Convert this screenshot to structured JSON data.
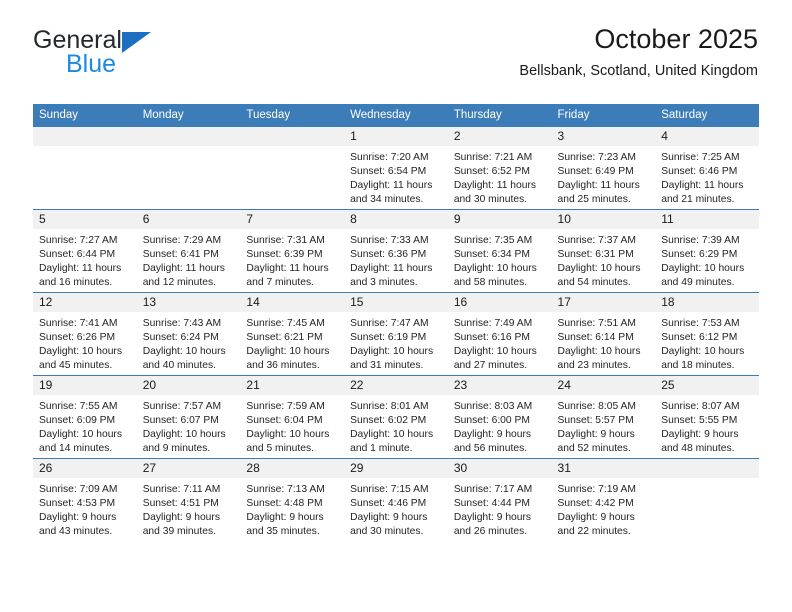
{
  "brand": {
    "name_top": "General",
    "name_bottom": "Blue",
    "triangle_color": "#1c6fc0",
    "bottom_color": "#1c8ae0"
  },
  "header": {
    "title": "October 2025",
    "subtitle": "Bellsbank, Scotland, United Kingdom"
  },
  "theme": {
    "header_blue": "#3c7cb8",
    "daynum_gray": "#f1f1f1",
    "text": "#1a1a1a"
  },
  "weekdays": [
    "Sunday",
    "Monday",
    "Tuesday",
    "Wednesday",
    "Thursday",
    "Friday",
    "Saturday"
  ],
  "labels": {
    "sunrise_prefix": "Sunrise:",
    "sunset_prefix": "Sunset:",
    "daylight_prefix": "Daylight:"
  },
  "weeks": [
    [
      {
        "day": "",
        "sunrise": "",
        "sunset": "",
        "daylight": ""
      },
      {
        "day": "",
        "sunrise": "",
        "sunset": "",
        "daylight": ""
      },
      {
        "day": "",
        "sunrise": "",
        "sunset": "",
        "daylight": ""
      },
      {
        "day": "1",
        "sunrise": "Sunrise: 7:20 AM",
        "sunset": "Sunset: 6:54 PM",
        "daylight": "Daylight: 11 hours and 34 minutes."
      },
      {
        "day": "2",
        "sunrise": "Sunrise: 7:21 AM",
        "sunset": "Sunset: 6:52 PM",
        "daylight": "Daylight: 11 hours and 30 minutes."
      },
      {
        "day": "3",
        "sunrise": "Sunrise: 7:23 AM",
        "sunset": "Sunset: 6:49 PM",
        "daylight": "Daylight: 11 hours and 25 minutes."
      },
      {
        "day": "4",
        "sunrise": "Sunrise: 7:25 AM",
        "sunset": "Sunset: 6:46 PM",
        "daylight": "Daylight: 11 hours and 21 minutes."
      }
    ],
    [
      {
        "day": "5",
        "sunrise": "Sunrise: 7:27 AM",
        "sunset": "Sunset: 6:44 PM",
        "daylight": "Daylight: 11 hours and 16 minutes."
      },
      {
        "day": "6",
        "sunrise": "Sunrise: 7:29 AM",
        "sunset": "Sunset: 6:41 PM",
        "daylight": "Daylight: 11 hours and 12 minutes."
      },
      {
        "day": "7",
        "sunrise": "Sunrise: 7:31 AM",
        "sunset": "Sunset: 6:39 PM",
        "daylight": "Daylight: 11 hours and 7 minutes."
      },
      {
        "day": "8",
        "sunrise": "Sunrise: 7:33 AM",
        "sunset": "Sunset: 6:36 PM",
        "daylight": "Daylight: 11 hours and 3 minutes."
      },
      {
        "day": "9",
        "sunrise": "Sunrise: 7:35 AM",
        "sunset": "Sunset: 6:34 PM",
        "daylight": "Daylight: 10 hours and 58 minutes."
      },
      {
        "day": "10",
        "sunrise": "Sunrise: 7:37 AM",
        "sunset": "Sunset: 6:31 PM",
        "daylight": "Daylight: 10 hours and 54 minutes."
      },
      {
        "day": "11",
        "sunrise": "Sunrise: 7:39 AM",
        "sunset": "Sunset: 6:29 PM",
        "daylight": "Daylight: 10 hours and 49 minutes."
      }
    ],
    [
      {
        "day": "12",
        "sunrise": "Sunrise: 7:41 AM",
        "sunset": "Sunset: 6:26 PM",
        "daylight": "Daylight: 10 hours and 45 minutes."
      },
      {
        "day": "13",
        "sunrise": "Sunrise: 7:43 AM",
        "sunset": "Sunset: 6:24 PM",
        "daylight": "Daylight: 10 hours and 40 minutes."
      },
      {
        "day": "14",
        "sunrise": "Sunrise: 7:45 AM",
        "sunset": "Sunset: 6:21 PM",
        "daylight": "Daylight: 10 hours and 36 minutes."
      },
      {
        "day": "15",
        "sunrise": "Sunrise: 7:47 AM",
        "sunset": "Sunset: 6:19 PM",
        "daylight": "Daylight: 10 hours and 31 minutes."
      },
      {
        "day": "16",
        "sunrise": "Sunrise: 7:49 AM",
        "sunset": "Sunset: 6:16 PM",
        "daylight": "Daylight: 10 hours and 27 minutes."
      },
      {
        "day": "17",
        "sunrise": "Sunrise: 7:51 AM",
        "sunset": "Sunset: 6:14 PM",
        "daylight": "Daylight: 10 hours and 23 minutes."
      },
      {
        "day": "18",
        "sunrise": "Sunrise: 7:53 AM",
        "sunset": "Sunset: 6:12 PM",
        "daylight": "Daylight: 10 hours and 18 minutes."
      }
    ],
    [
      {
        "day": "19",
        "sunrise": "Sunrise: 7:55 AM",
        "sunset": "Sunset: 6:09 PM",
        "daylight": "Daylight: 10 hours and 14 minutes."
      },
      {
        "day": "20",
        "sunrise": "Sunrise: 7:57 AM",
        "sunset": "Sunset: 6:07 PM",
        "daylight": "Daylight: 10 hours and 9 minutes."
      },
      {
        "day": "21",
        "sunrise": "Sunrise: 7:59 AM",
        "sunset": "Sunset: 6:04 PM",
        "daylight": "Daylight: 10 hours and 5 minutes."
      },
      {
        "day": "22",
        "sunrise": "Sunrise: 8:01 AM",
        "sunset": "Sunset: 6:02 PM",
        "daylight": "Daylight: 10 hours and 1 minute."
      },
      {
        "day": "23",
        "sunrise": "Sunrise: 8:03 AM",
        "sunset": "Sunset: 6:00 PM",
        "daylight": "Daylight: 9 hours and 56 minutes."
      },
      {
        "day": "24",
        "sunrise": "Sunrise: 8:05 AM",
        "sunset": "Sunset: 5:57 PM",
        "daylight": "Daylight: 9 hours and 52 minutes."
      },
      {
        "day": "25",
        "sunrise": "Sunrise: 8:07 AM",
        "sunset": "Sunset: 5:55 PM",
        "daylight": "Daylight: 9 hours and 48 minutes."
      }
    ],
    [
      {
        "day": "26",
        "sunrise": "Sunrise: 7:09 AM",
        "sunset": "Sunset: 4:53 PM",
        "daylight": "Daylight: 9 hours and 43 minutes."
      },
      {
        "day": "27",
        "sunrise": "Sunrise: 7:11 AM",
        "sunset": "Sunset: 4:51 PM",
        "daylight": "Daylight: 9 hours and 39 minutes."
      },
      {
        "day": "28",
        "sunrise": "Sunrise: 7:13 AM",
        "sunset": "Sunset: 4:48 PM",
        "daylight": "Daylight: 9 hours and 35 minutes."
      },
      {
        "day": "29",
        "sunrise": "Sunrise: 7:15 AM",
        "sunset": "Sunset: 4:46 PM",
        "daylight": "Daylight: 9 hours and 30 minutes."
      },
      {
        "day": "30",
        "sunrise": "Sunrise: 7:17 AM",
        "sunset": "Sunset: 4:44 PM",
        "daylight": "Daylight: 9 hours and 26 minutes."
      },
      {
        "day": "31",
        "sunrise": "Sunrise: 7:19 AM",
        "sunset": "Sunset: 4:42 PM",
        "daylight": "Daylight: 9 hours and 22 minutes."
      },
      {
        "day": "",
        "sunrise": "",
        "sunset": "",
        "daylight": ""
      }
    ]
  ]
}
